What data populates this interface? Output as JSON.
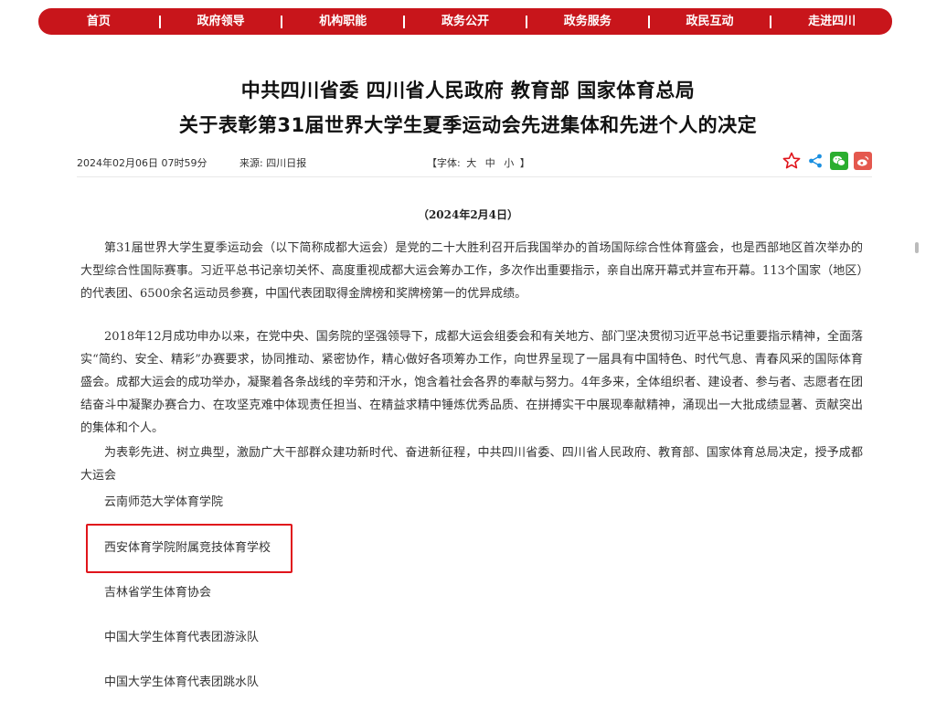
{
  "nav": {
    "items": [
      "首页",
      "政府领导",
      "机构职能",
      "政务公开",
      "政务服务",
      "政民互动",
      "走进四川"
    ],
    "separator": "|"
  },
  "article": {
    "title_line1": "中共四川省委 四川省人民政府 教育部 国家体育总局",
    "title_line2": "关于表彰第31届世界大学生夏季运动会先进集体和先进个人的决定",
    "publish_time": "2024年02月06日 07时59分",
    "source": "来源: 四川日报",
    "font_label": "【字体:",
    "font_sizes": [
      "大",
      "中",
      "小"
    ],
    "font_close": "】",
    "decision_date": "（2024年2月4日）",
    "paragraphs": [
      "第31届世界大学生夏季运动会（以下简称成都大运会）是党的二十大胜利召开后我国举办的首场国际综合性体育盛会，也是西部地区首次举办的大型综合性国际赛事。习近平总书记亲切关怀、高度重视成都大运会筹办工作，多次作出重要指示，亲自出席开幕式并宣布开幕。113个国家（地区）的代表团、6500余名运动员参赛，中国代表团取得金牌榜和奖牌榜第一的优异成绩。",
      "2018年12月成功申办以来，在党中央、国务院的坚强领导下，成都大运会组委会和有关地方、部门坚决贯彻习近平总书记重要指示精神，全面落实“简约、安全、精彩”办赛要求，协同推动、紧密协作，精心做好各项筹办工作，向世界呈现了一届具有中国特色、时代气息、青春风采的国际体育盛会。成都大运会的成功举办，凝聚着各条战线的辛劳和汗水，饱含着社会各界的奉献与努力。4年多来，全体组织者、建设者、参与者、志愿者在团结奋斗中凝聚办赛合力、在攻坚克难中体现责任担当、在精益求精中锤炼优秀品质、在拼搏实干中展现奉献精神，涌现出一大批成绩显著、贡献突出的集体和个人。",
      "为表彰先进、树立典型，激励广大干部群众建功新时代、奋进新征程，中共四川省委、四川省人民政府、教育部、国家体育总局决定，授予成都大运会"
    ],
    "honorees": [
      "云南师范大学体育学院",
      "西安体育学院附属竞技体育学校",
      "吉林省学生体育协会",
      "中国大学生体育代表团游泳队",
      "中国大学生体育代表团跳水队"
    ]
  },
  "share": {
    "icons": [
      "star-icon",
      "share-icon",
      "wechat-icon",
      "weibo-icon"
    ]
  },
  "colors": {
    "nav_bg": "#c8151b",
    "highlight": "#e0141b",
    "star": "#e0141b",
    "share": "#1a8fe0",
    "wechat": "#2aae2f",
    "weibo": "#e4584e"
  }
}
